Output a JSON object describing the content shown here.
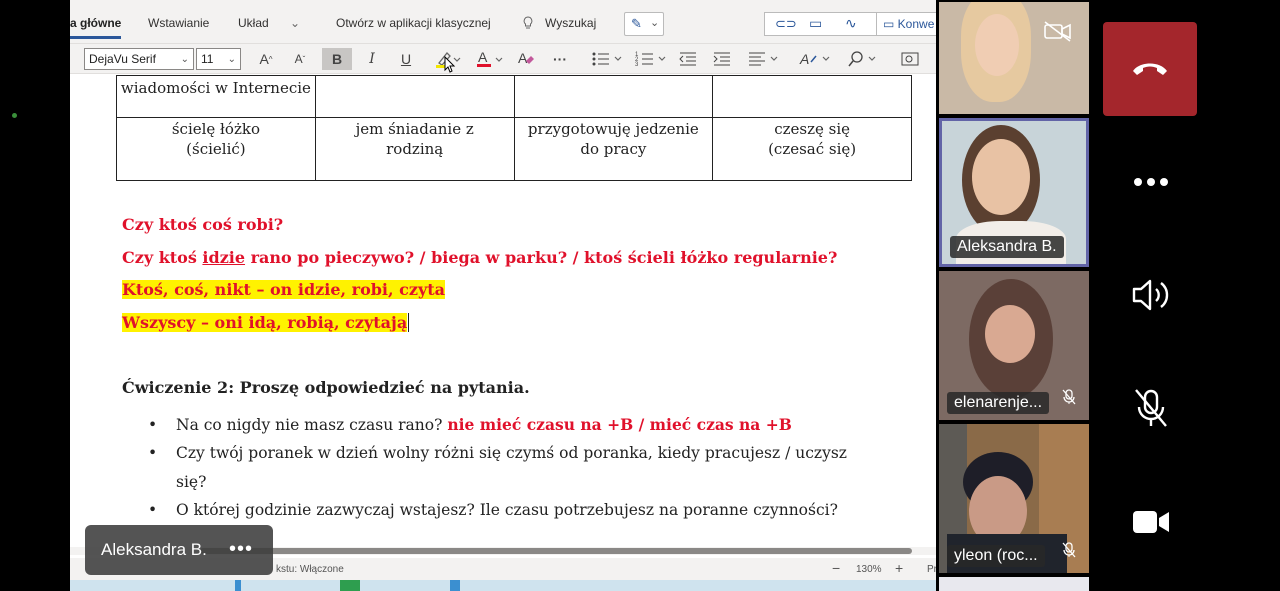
{
  "ribbon": {
    "tabs": [
      "a główne",
      "Wstawianie",
      "Układ",
      "Otwórz w aplikacji klasycznej",
      "Wyszukaj"
    ],
    "right_button": "Konwe"
  },
  "toolbar": {
    "font": "DejaVu Serif",
    "size": "11",
    "bold": "B",
    "italic": "I",
    "underline": "U",
    "more": "···",
    "grow": "A",
    "shrink": "A"
  },
  "table": {
    "rows": [
      [
        "wiadomości w Internecie",
        "",
        "",
        ""
      ],
      [
        "ścielę łóżko (ścielić)",
        "jem śniadanie z rodziną",
        "przygotowuję jedzenie do pracy",
        "czeszę się (czesać się)"
      ]
    ]
  },
  "doc": {
    "q1": "Czy ktoś coś robi?",
    "q2_pre": "Czy ktoś ",
    "q2_word": "idzie",
    "q2_post": " rano po pieczywo? / biega w parku? / ktoś ścieli łóżko regularnie?",
    "h1": "Ktoś, coś, nikt – on idzie, robi, czyta",
    "h2": "Wszyscy – oni idą, robią, czytają",
    "ex_title": "Ćwiczenie 2: Proszę odpowiedzieć na pytania.",
    "b1_text": "Na co nigdy nie masz czasu rano? ",
    "b1_red": "nie mieć czasu na +B / mieć czas na +B",
    "b2_line1": "Czy twój poranek w dzień wolny różni się czymś od poranka, kiedy pracujesz / uczysz",
    "b2_line2": "się?",
    "b3_text": "O której godzinie zazwyczaj wstajesz? Ile czasu potrzebujesz na poranne czynności?"
  },
  "status": {
    "left": "kstu: Włączone",
    "zoom": "130%",
    "minus": "−",
    "plus": "+",
    "pr": "Pr"
  },
  "presenter": {
    "name": "Aleksandra B.",
    "more": "•••"
  },
  "participants": [
    {
      "name": ""
    },
    {
      "name": "Aleksandra B."
    },
    {
      "name": "elenarenje..."
    },
    {
      "name": "yleon (roc..."
    }
  ],
  "colors": {
    "leave": "#a4262c",
    "accent": "#2b579a",
    "highlight": "#fff200",
    "red_text": "#e0112b"
  }
}
